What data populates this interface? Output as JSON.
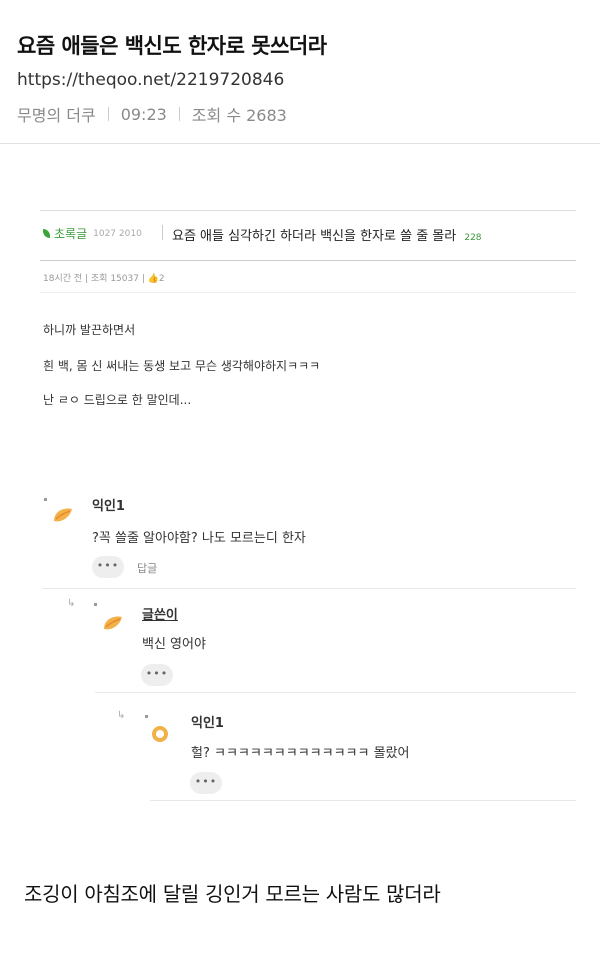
{
  "post": {
    "title": "요즘 애들은 백신도 한자로 못쓰더라",
    "url": "https://theqoo.net/2219720846",
    "author": "무명의 더쿠",
    "time": "09:23",
    "views_label": "조회 수 2683"
  },
  "capture": {
    "board": "초록글",
    "board_num": "1027 2010",
    "title": "요즘 애들 심각하긴 하더라 백신을 한자로 쓸 줄 몰라",
    "title_count": "228",
    "meta": "18시간 전 | 조회 15037 | 👍2",
    "body": [
      "하니까 발끈하면서",
      "흰 백, 몸 신 써내는 동생 보고 무슨 생각해야하지ㅋㅋㅋ",
      "난 ㄹㅇ 드립으로 한 말인데..."
    ],
    "comments": [
      {
        "name": "익인1",
        "text": "?꼭 쓸줄 알아야함? 나도 모르는디 한자",
        "more": "•••",
        "reply": "답글"
      },
      {
        "name": "글쓴이",
        "text": "백신 영어야",
        "more": "•••"
      },
      {
        "name": "익인1",
        "text": "헐? ㅋㅋㅋㅋㅋㅋㅋㅋㅋㅋㅋㅋㅋ 몰랐어",
        "more": "•••"
      }
    ]
  },
  "caption": "조깅이 아침조에 달릴 깅인거 모르는 사람도 많더라",
  "colors": {
    "accent": "#3a9a3a",
    "meta": "#8a8a8a"
  }
}
